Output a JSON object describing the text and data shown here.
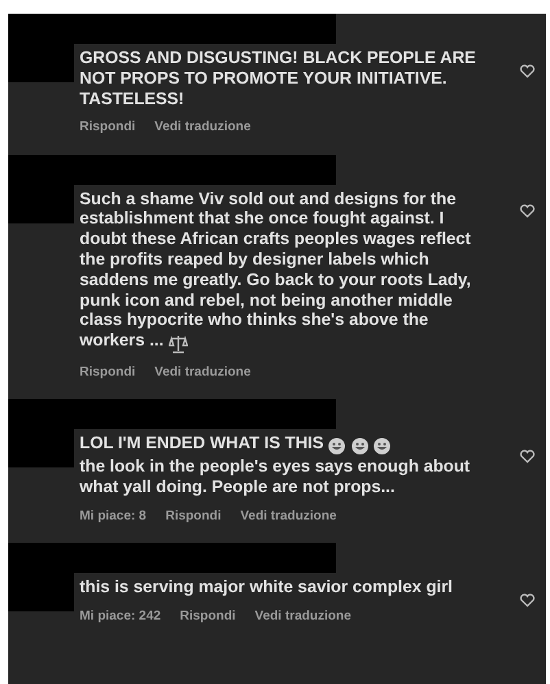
{
  "comments": [
    {
      "redacted": true,
      "text": "GROSS AND DISGUSTING! BLACK PEOPLE ARE NOT PROPS TO PROMOTE YOUR INITIATIVE. TASTELESS!",
      "reply": "Rispondi",
      "translate": "Vedi traduzione"
    },
    {
      "redacted": true,
      "text": "Such a shame Viv sold out and designs for the establishment that she once fought against. I doubt these African crafts peoples wages reflect the profits reaped by designer labels which saddens me greatly. Go back to your roots Lady, punk icon and rebel, not being another middle class hypocrite who thinks she's above the workers ...",
      "trailing_icons": [
        {
          "kind": "scale"
        }
      ],
      "reply": "Rispondi",
      "translate": "Vedi traduzione"
    },
    {
      "redacted": true,
      "text": "LOL I'M ENDED WHAT IS THIS",
      "trailing_icons": [
        {
          "kind": "emoji"
        },
        {
          "kind": "emoji"
        },
        {
          "kind": "emoji"
        }
      ],
      "rest": "the look in the people's eyes says enough about what yall doing. People are not props...",
      "likes": "Mi piace: 8",
      "reply": "Rispondi",
      "translate": "Vedi traduzione"
    },
    {
      "redacted": true,
      "text": "this is serving major white savior complex girl",
      "likes": "Mi piace: 242",
      "reply": "Rispondi",
      "translate": "Vedi traduzione"
    }
  ]
}
